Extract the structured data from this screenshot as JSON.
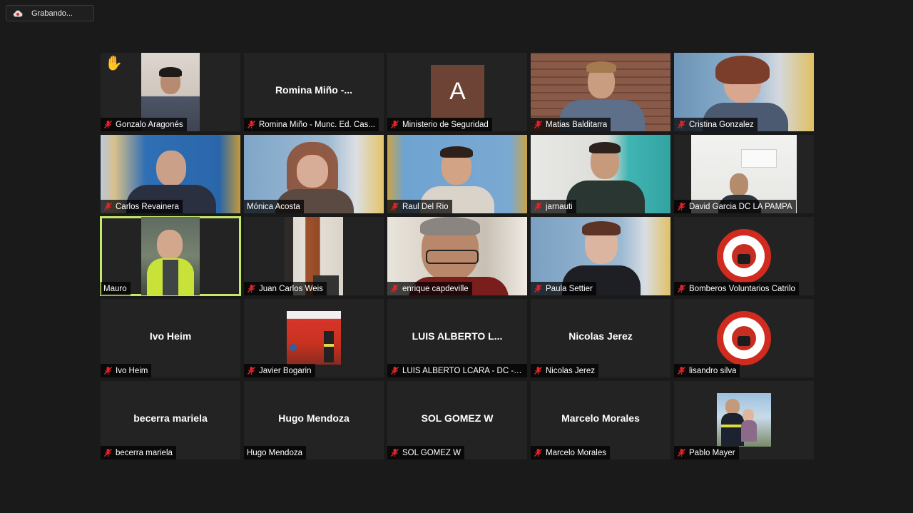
{
  "recording": {
    "label": "Grabando...",
    "icon": "cloud-record-icon"
  },
  "colors": {
    "active_speaker": "#c4e86a",
    "muted_icon": "#e0242a",
    "tile_bg": "#232323",
    "avatar_bg": "#6d4335"
  },
  "participants": [
    {
      "name": "Gonzalo Aragonés",
      "muted": true,
      "hand_raised": true,
      "display": "video"
    },
    {
      "name": "Romina Miño - Munc. Ed. Cas...",
      "center_name": "Romina Miño -...",
      "muted": true,
      "display": "name"
    },
    {
      "name": "Ministerio de Seguridad",
      "avatar_letter": "A",
      "muted": true,
      "display": "avatar"
    },
    {
      "name": "Matias Balditarra",
      "muted": true,
      "display": "video"
    },
    {
      "name": "Cristina Gonzalez",
      "muted": true,
      "display": "video"
    },
    {
      "name": "Carlos Revainera",
      "muted": true,
      "display": "video"
    },
    {
      "name": "Mónica Acosta",
      "muted": false,
      "display": "video"
    },
    {
      "name": "Raul Del Rio",
      "muted": true,
      "display": "video"
    },
    {
      "name": "jarnauti",
      "muted": true,
      "display": "video"
    },
    {
      "name": "David Garcia DC LA PAMPA",
      "muted": true,
      "display": "video"
    },
    {
      "name": "Mauro",
      "muted": false,
      "active": true,
      "display": "video"
    },
    {
      "name": "Juan Carlos Weis",
      "muted": true,
      "display": "video"
    },
    {
      "name": "enrique capdeville",
      "muted": true,
      "display": "video"
    },
    {
      "name": "Paula Settier",
      "muted": true,
      "display": "video"
    },
    {
      "name": "Bomberos Voluntarios Catrilo",
      "muted": true,
      "display": "logo"
    },
    {
      "name": "Ivo Heim",
      "center_name": "Ivo Heim",
      "muted": true,
      "display": "name"
    },
    {
      "name": "Javier Bogarin",
      "muted": true,
      "display": "picture"
    },
    {
      "name": "LUIS ALBERTO LCARA - DC - L...",
      "center_name": "LUIS ALBERTO L...",
      "muted": true,
      "display": "name"
    },
    {
      "name": "Nicolas Jerez",
      "center_name": "Nicolas Jerez",
      "muted": true,
      "display": "name"
    },
    {
      "name": "lisandro silva",
      "muted": true,
      "display": "logo"
    },
    {
      "name": "becerra mariela",
      "center_name": "becerra mariela",
      "muted": true,
      "display": "name"
    },
    {
      "name": "Hugo Mendoza",
      "center_name": "Hugo Mendoza",
      "muted": false,
      "display": "name"
    },
    {
      "name": "SOL GOMEZ W",
      "center_name": "SOL GOMEZ W",
      "muted": true,
      "display": "name"
    },
    {
      "name": "Marcelo Morales",
      "center_name": "Marcelo Morales",
      "muted": true,
      "display": "name"
    },
    {
      "name": "Pablo Mayer",
      "muted": true,
      "display": "picture"
    }
  ]
}
